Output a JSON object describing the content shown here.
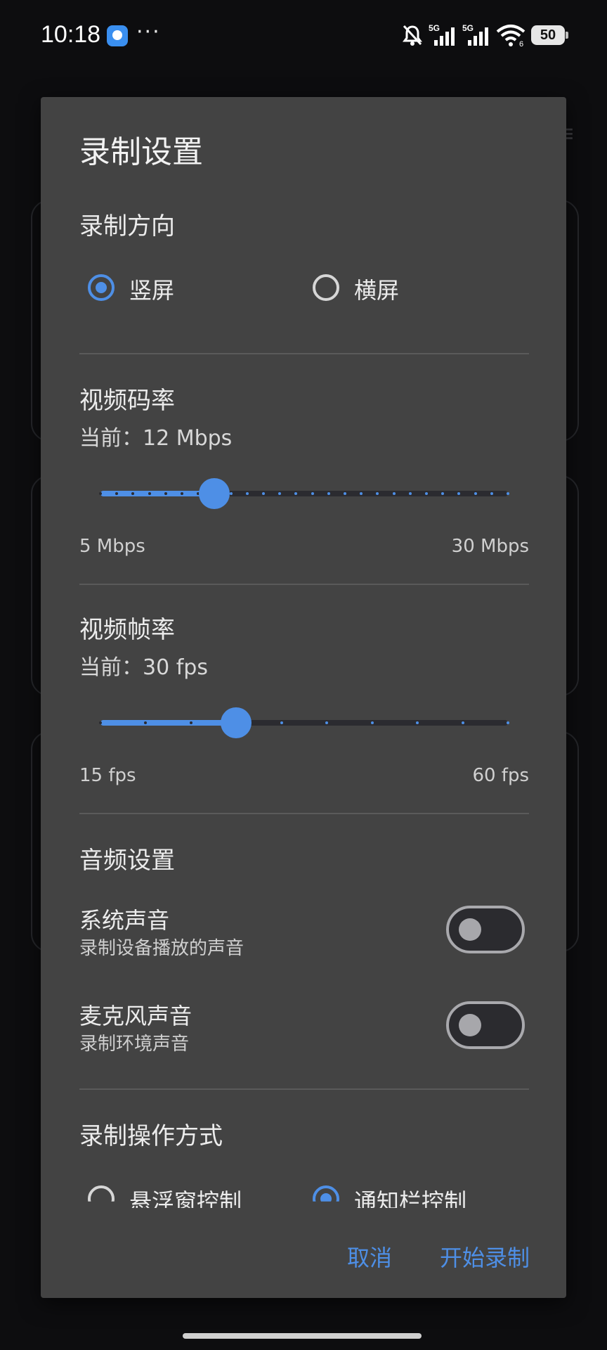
{
  "status_bar": {
    "time": "10:18",
    "dots": "···",
    "signal_label_1": "5G",
    "signal_label_2": "5G",
    "wifi_label": "6",
    "battery": "50"
  },
  "dialog": {
    "title": "录制设置",
    "orientation": {
      "title": "录制方向",
      "options": [
        {
          "label": "竖屏",
          "selected": true
        },
        {
          "label": "横屏",
          "selected": false
        }
      ]
    },
    "bitrate": {
      "title": "视频码率",
      "current": "当前：12 Mbps",
      "min_label": "5 Mbps",
      "max_label": "30 Mbps",
      "min": 5,
      "max": 30,
      "value": 12,
      "step": 1
    },
    "framerate": {
      "title": "视频帧率",
      "current": "当前：30 fps",
      "min_label": "15 fps",
      "max_label": "60 fps",
      "min": 15,
      "max": 60,
      "value": 30,
      "step": 5
    },
    "audio": {
      "title": "音频设置",
      "system_sound": {
        "title": "系统声音",
        "subtitle": "录制设备播放的声音",
        "enabled": false
      },
      "mic_sound": {
        "title": "麦克风声音",
        "subtitle": "录制环境声音",
        "enabled": false
      }
    },
    "control_mode": {
      "title": "录制操作方式",
      "options": [
        {
          "label": "悬浮窗控制",
          "selected": false
        },
        {
          "label": "通知栏控制",
          "selected": true
        }
      ]
    },
    "cancel_label": "取消",
    "start_label": "开始录制"
  },
  "colors": {
    "accent": "#4e8fe6",
    "dialog_bg": "#434343",
    "screen_bg": "#0d0d0f"
  }
}
